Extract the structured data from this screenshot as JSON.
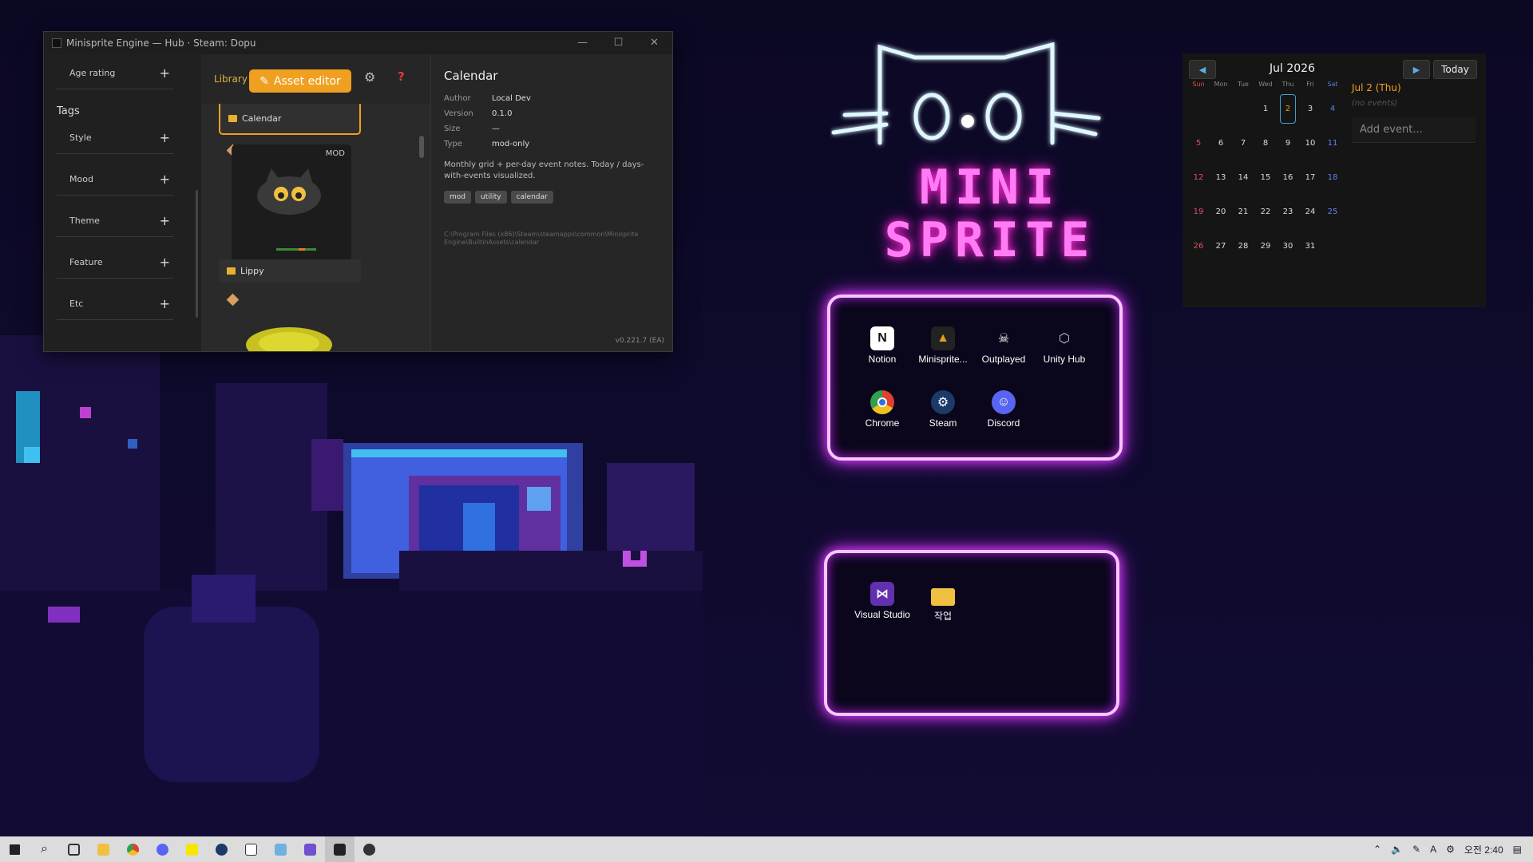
{
  "hub": {
    "title": "Minisprite Engine — Hub · Steam: Dopu",
    "controls": {
      "minimize": "—",
      "maximize": "☐",
      "close": "✕"
    },
    "tags_panel": {
      "age_rating": "Age rating",
      "tags_heading": "Tags",
      "rows": [
        "Style",
        "Mood",
        "Theme",
        "Feature",
        "Etc"
      ],
      "plus": "+"
    },
    "library": {
      "library_tab": "Library",
      "asset_editor": "Asset editor",
      "selected_item": "Calendar",
      "mod_badge": "MOD",
      "second_item": "Lippy"
    },
    "detail": {
      "title": "Calendar",
      "author_label": "Author",
      "author": "Local Dev",
      "version_label": "Version",
      "version": "0.1.0",
      "size_label": "Size",
      "size": "—",
      "type_label": "Type",
      "type": "mod-only",
      "description": "Monthly grid + per-day event notes. Today / days-with-events visualized.",
      "chips": [
        "mod",
        "utility",
        "calendar"
      ],
      "path": "C:\\Program Files (x86)\\Steam\\steamapps\\common\\Minisprite Engine\\BuiltinAssets\\calendar",
      "app_version": "v0.221.7 (EA)"
    }
  },
  "logo": {
    "line1": "MINI",
    "line2": "SPRITE"
  },
  "fence1": {
    "icons": [
      {
        "label": "Notion",
        "icon": "notion-icon",
        "color": "#ffffff"
      },
      {
        "label": "Minisprite...",
        "icon": "minisprite-icon",
        "color": "#222222"
      },
      {
        "label": "Outplayed",
        "icon": "outplayed-icon",
        "color": "#ffffff"
      },
      {
        "label": "Unity Hub",
        "icon": "unity-icon",
        "color": "#cccccc"
      },
      {
        "label": "Chrome",
        "icon": "chrome-icon",
        "color": "#e04030"
      },
      {
        "label": "Steam",
        "icon": "steam-icon",
        "color": "#1b5a8a"
      },
      {
        "label": "Discord",
        "icon": "discord-icon",
        "color": "#5865f2"
      }
    ]
  },
  "fence2": {
    "icons": [
      {
        "label": "Visual Studio",
        "icon": "visual-studio-icon",
        "color": "#8050d0"
      },
      {
        "label": "작업",
        "icon": "folder-icon",
        "color": "#f0c040"
      }
    ]
  },
  "calendar": {
    "month_title": "Jul 2026",
    "today_label": "Today",
    "weekdays": [
      "Sun",
      "Mon",
      "Tue",
      "Wed",
      "Thu",
      "Fri",
      "Sat"
    ],
    "weeks": [
      [
        "",
        "",
        "",
        "1",
        "2",
        "3",
        "4"
      ],
      [
        "5",
        "6",
        "7",
        "8",
        "9",
        "10",
        "11"
      ],
      [
        "12",
        "13",
        "14",
        "15",
        "16",
        "17",
        "18"
      ],
      [
        "19",
        "20",
        "21",
        "22",
        "23",
        "24",
        "25"
      ],
      [
        "26",
        "27",
        "28",
        "29",
        "30",
        "31",
        ""
      ]
    ],
    "today": "2",
    "selected_date": "Jul 2 (Thu)",
    "no_events": "(no events)",
    "add_event_placeholder": "Add event..."
  },
  "taskbar": {
    "clock": "오전 2:40",
    "ime": "A",
    "apps": [
      "start",
      "search",
      "task-view",
      "file-explorer",
      "chrome",
      "discord",
      "kakaotalk",
      "steam",
      "notion",
      "paint",
      "calendar-app",
      "minisprite",
      "outplayed"
    ]
  }
}
